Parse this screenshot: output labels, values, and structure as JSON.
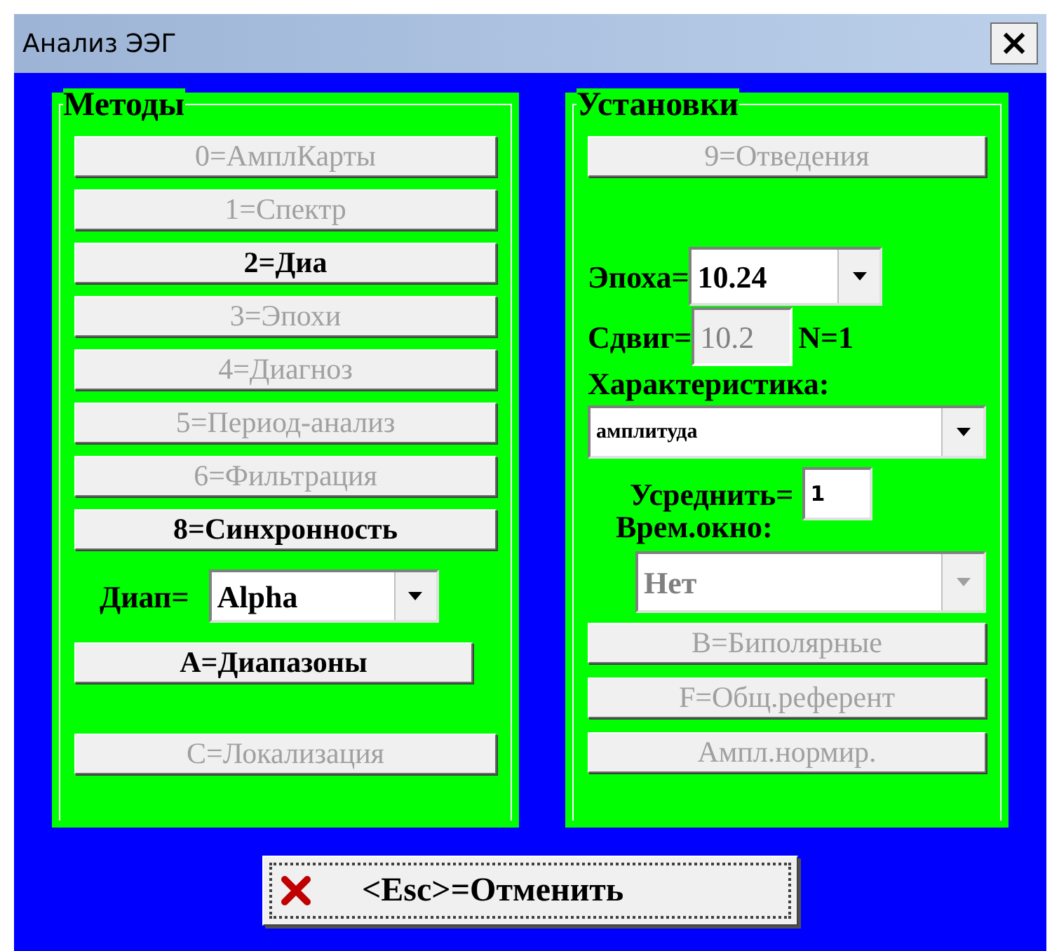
{
  "window": {
    "title": "Анализ ЭЭГ",
    "close": "×"
  },
  "methods": {
    "legend": "Методы",
    "buttons": [
      {
        "label": "0=АмплКарты",
        "disabled": true
      },
      {
        "label": "1=Спектр",
        "disabled": true
      },
      {
        "label": "2=Диа",
        "disabled": false
      },
      {
        "label": "3=Эпохи",
        "disabled": true
      },
      {
        "label": "4=Диагноз",
        "disabled": true
      },
      {
        "label": "5=Период-анализ",
        "disabled": true
      },
      {
        "label": "6=Фильтрация",
        "disabled": true
      },
      {
        "label": "8=Синхронность",
        "disabled": false
      }
    ],
    "range": {
      "label": "Диап=",
      "value": "Alpha"
    },
    "ranges_button": {
      "label": "A=Диапазоны",
      "disabled": false
    },
    "localization_button": {
      "label": "C=Локализация",
      "disabled": true
    }
  },
  "settings": {
    "legend": "Установки",
    "leads_button": {
      "label": "9=Отведения",
      "disabled": true
    },
    "epoch": {
      "label": "Эпоха=",
      "value": "10.24"
    },
    "shift": {
      "label": "Сдвиг=",
      "value": "10.2",
      "disabled": true
    },
    "n": "N=1",
    "characteristic": {
      "label": "Характеристика:",
      "value": "амплитуда"
    },
    "average": {
      "label": "Усреднить=",
      "value": "1"
    },
    "time_window": {
      "label": "Врем.окно:",
      "value": "Нет",
      "disabled": true
    },
    "buttons": [
      {
        "label": "B=Биполярные",
        "disabled": true
      },
      {
        "label": "F=Общ.референт",
        "disabled": true
      },
      {
        "label": "Ампл.нормир.",
        "disabled": true
      }
    ]
  },
  "cancel_button": {
    "label": "<Esc>=Отменить"
  }
}
